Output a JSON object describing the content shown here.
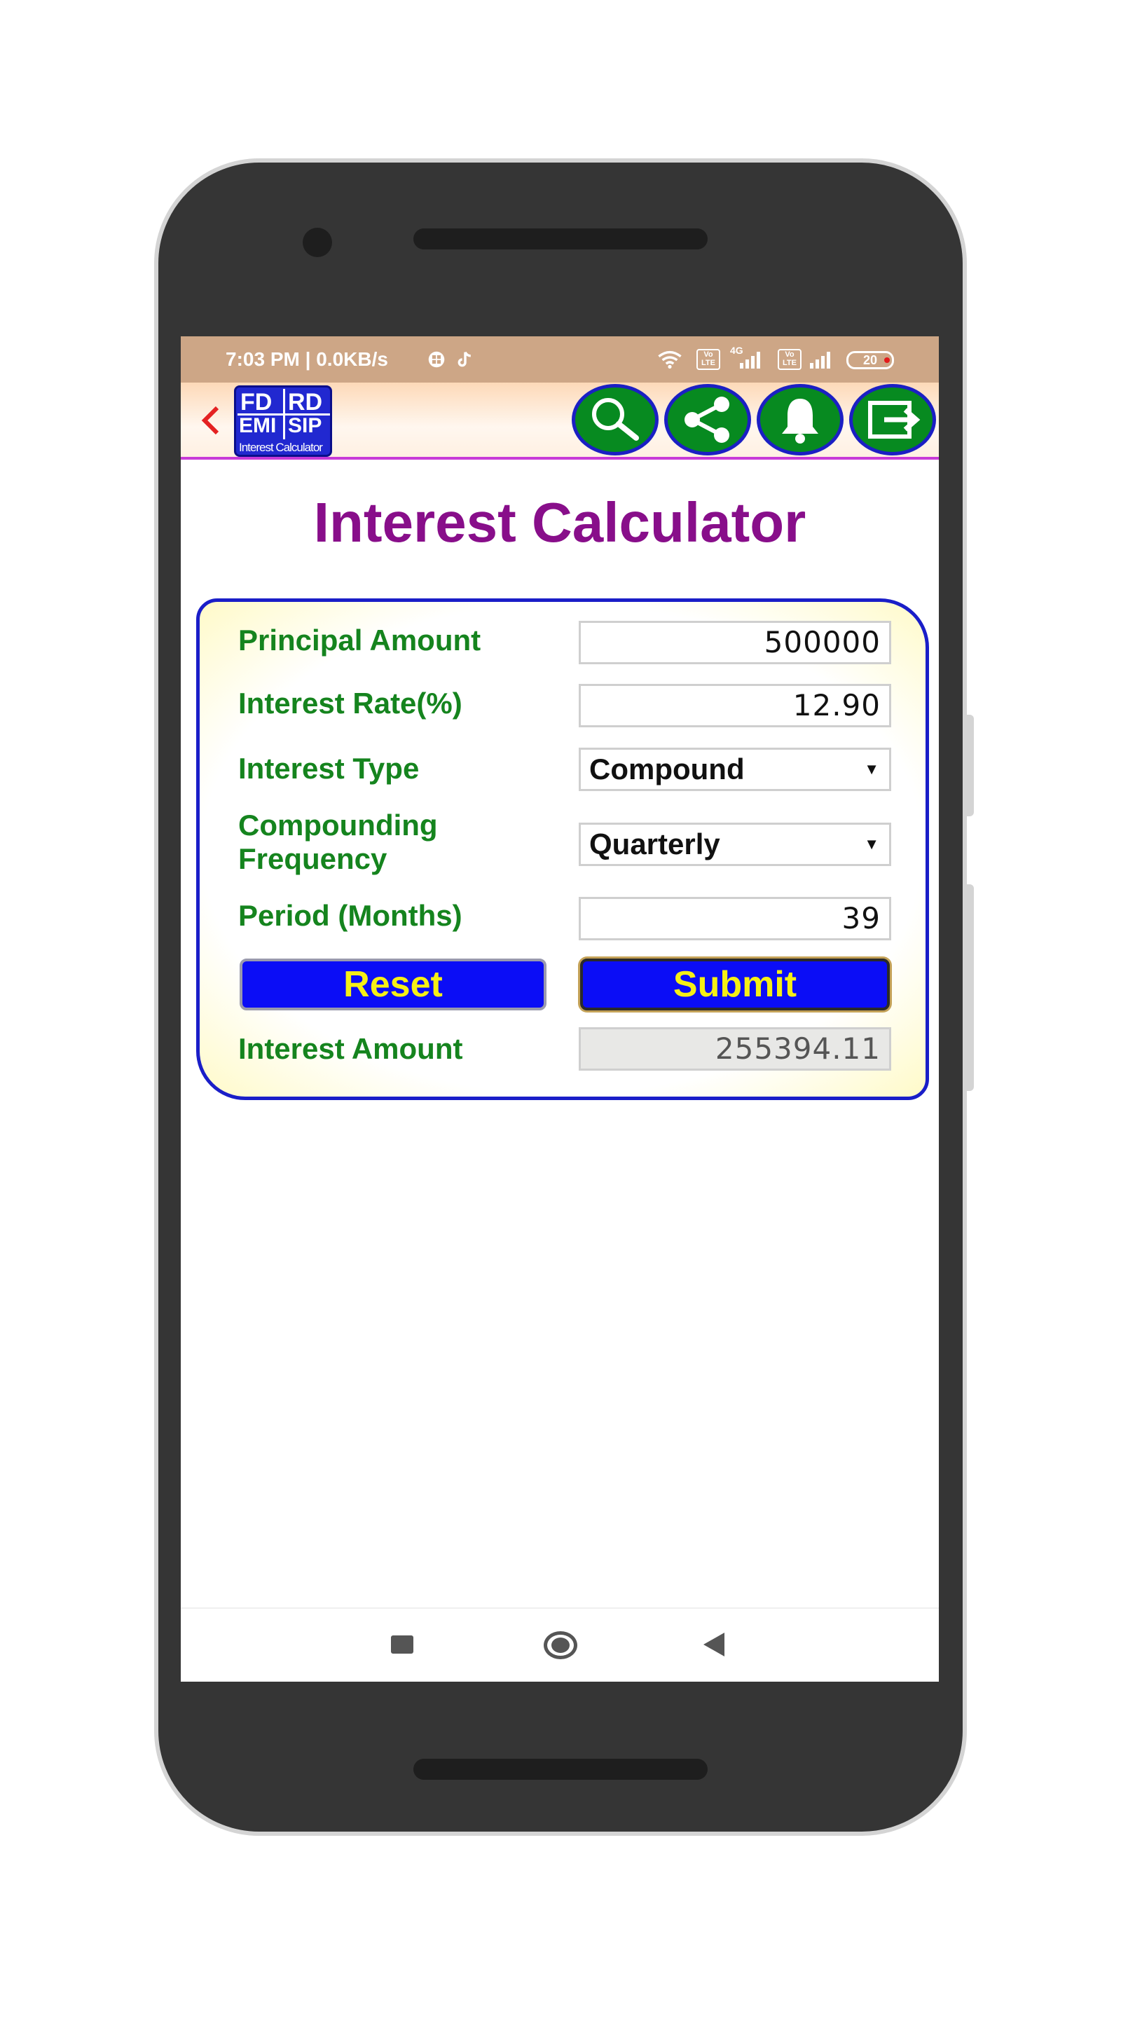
{
  "status_bar": {
    "time_text": "7:03 PM | 0.0KB/s",
    "network_4g": "4G",
    "volte_label_1": "Vo LTE",
    "volte_label_2": "Vo LTE",
    "battery_level": "20"
  },
  "app_bar": {
    "logo": {
      "top_left": "FD",
      "top_right": "RD",
      "bottom_left": "EMI",
      "bottom_right": "SIP",
      "subtitle": "Interest Calculator"
    },
    "icons": [
      "search-icon",
      "share-icon",
      "bell-icon",
      "exit-icon"
    ]
  },
  "page": {
    "title": "Interest Calculator"
  },
  "form": {
    "principal_label": "Principal Amount",
    "principal_value": "500000",
    "rate_label": "Interest Rate(%)",
    "rate_value": "12.90",
    "type_label": "Interest Type",
    "type_value": "Compound",
    "frequency_label_line1": "Compounding",
    "frequency_label_line2": "Frequency",
    "frequency_value": "Quarterly",
    "period_label": "Period (Months)",
    "period_value": "39",
    "reset_label": "Reset",
    "submit_label": "Submit",
    "result_label": "Interest Amount",
    "result_value": "255394.11"
  },
  "colors": {
    "title": "#880e8a",
    "labels": "#15841e",
    "button_bg": "#0b0df6",
    "button_text": "#f5ef16",
    "icon_circle": "#078a20",
    "status_bar": "#cda686"
  }
}
